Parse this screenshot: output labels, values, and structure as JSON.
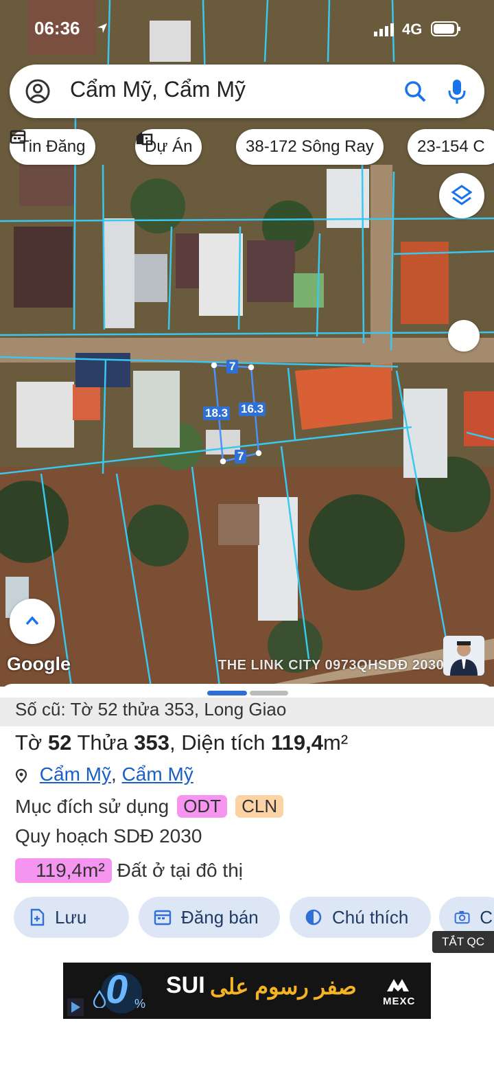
{
  "status_bar": {
    "time": "06:36",
    "network": "4G"
  },
  "search": {
    "value": "Cẩm Mỹ, Cẩm Mỹ"
  },
  "chips": [
    {
      "label": "Tin Đăng",
      "icon": "calendar-icon"
    },
    {
      "label": "Dự Án",
      "icon": "building-icon"
    },
    {
      "label": "38-172 Sông Ray"
    },
    {
      "label": "23-154 C"
    }
  ],
  "map": {
    "attribution": "Google",
    "watermark": "THE LINK CITY 0973QHSDĐ 2030",
    "parcel_labels": {
      "top": "7",
      "left": "18.3",
      "right": "16.3",
      "bottom": "7"
    }
  },
  "sheet": {
    "old_info": "Số cũ: Tờ 52 thửa 353, Long Giao",
    "title": {
      "to_label": "Tờ",
      "to_num": "52",
      "thua_label": "Thửa",
      "thua_num": "353",
      "area_label": ", Diện tích",
      "area_value": "119,4",
      "area_unit": "m²"
    },
    "location": {
      "commune": "Cẩm Mỹ",
      "separator": ",",
      "district": "Cẩm Mỹ"
    },
    "purpose": {
      "label": "Mục đích sử dụng",
      "codes": [
        {
          "code": "ODT",
          "color": "#f595ef"
        },
        {
          "code": "CLN",
          "color": "#fbd3a4"
        }
      ]
    },
    "plan": "Quy hoạch SDĐ 2030",
    "area_row": {
      "value": "119,4m²",
      "desc": "Đất ở tại đô thị",
      "color": "#f595ef"
    },
    "actions": [
      {
        "label": "Lưu",
        "icon": "add-doc-icon"
      },
      {
        "label": "Đăng bán",
        "icon": "calendar-icon"
      },
      {
        "label": "Chú thích",
        "icon": "contrast-icon"
      },
      {
        "label": "C",
        "icon": "camera-icon"
      }
    ],
    "hide_ads": "TẮT QC",
    "ad": {
      "zero": "0",
      "percent": "%",
      "coin": "SUI",
      "arabic": "صفر رسوم على",
      "brand": "MEXC"
    }
  },
  "colors": {
    "accent": "#1a73e8",
    "parcel_line": "#38c8f0",
    "action_bg": "#dde6f4"
  }
}
